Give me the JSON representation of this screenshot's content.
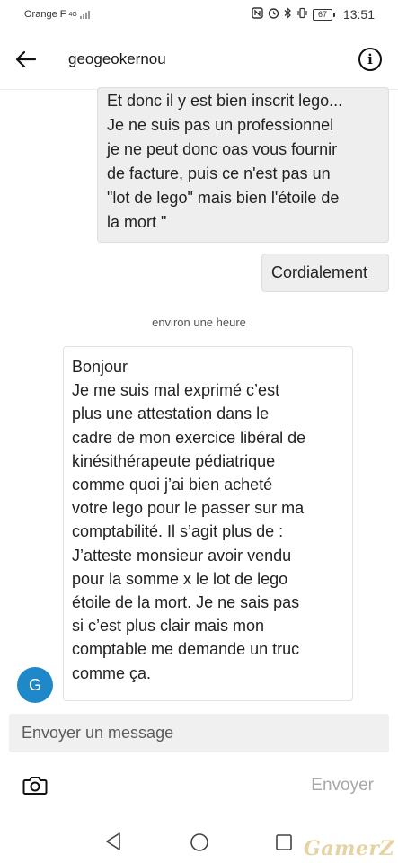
{
  "status_bar": {
    "carrier": "Orange F",
    "network_badge": "4G",
    "battery_level": "67",
    "time": "13:51",
    "icons": [
      "nfc-icon",
      "alarm-icon",
      "bluetooth-icon",
      "vibrate-icon",
      "battery-icon"
    ]
  },
  "header": {
    "back_icon": "arrow-left-icon",
    "title": "geogeokernou",
    "info_icon": "info-icon"
  },
  "messages": [
    {
      "sender": "me",
      "text": "Et donc il y est bien inscrit lego...\nJe ne suis pas un professionnel\nje ne peut donc oas vous fournir\nde facture, puis ce n'est pas un\n\"lot de lego\" mais bien l'étoile de\nla mort \""
    },
    {
      "sender": "me",
      "text": "Cordialement"
    },
    {
      "sender": "them",
      "text": "Bonjour\nJe me suis mal exprimé c’est\nplus une attestation dans le\ncadre de mon exercice libéral de\nkinésithérapeute pédiatrique\ncomme quoi j’ai bien acheté\nvotre lego pour le passer sur ma\ncomptabilité. Il s’agit plus de :\nJ’atteste monsieur avoir vendu\npour la somme x le lot de lego\nétoile de la mort. Je ne sais pas\nsi c’est plus clair mais mon\ncomptable me demande un truc\ncomme ça."
    }
  ],
  "timestamp": "environ une heure",
  "avatar_initial": "G",
  "composer": {
    "placeholder": "Envoyer un message",
    "send_label": "Envoyer",
    "camera_icon": "camera-icon"
  },
  "nav_bar": {
    "icons": [
      "nav-back-icon",
      "nav-home-icon",
      "nav-recent-icon"
    ]
  },
  "watermark": "GamerZ",
  "colors": {
    "avatar_bg": "#1e88c9",
    "my_bubble_bg": "#eeeeee",
    "input_bg": "#f0f0f0",
    "send_disabled": "#a8a8a8"
  }
}
